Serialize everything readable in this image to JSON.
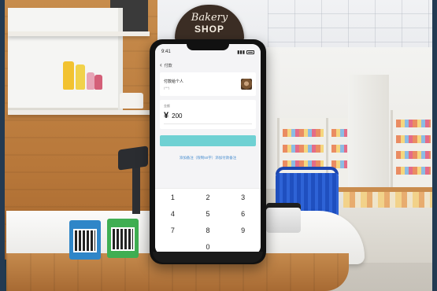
{
  "scene": {
    "shop_sign": {
      "script_text": "Bakery",
      "sub_text": "SHOP"
    }
  },
  "phone": {
    "status_time": "9:41",
    "nav_title": "付款",
    "merchant": {
      "name": "付款给个人",
      "sub": "(***)",
      "logo_icon": "merchant-logo-icon"
    },
    "amount": {
      "label": "金额",
      "currency_symbol": "¥",
      "value": "200"
    },
    "pay_button_label": "",
    "remark_link": "添加备注（限制50字）添加付款备注",
    "keypad": [
      "1",
      "2",
      "3",
      "4",
      "5",
      "6",
      "7",
      "8",
      "9",
      "0"
    ]
  },
  "colors": {
    "pay_button": "#6fd1d3",
    "link": "#4a8fd0",
    "wood": "#b9793b",
    "basket": "#1f4fbf"
  }
}
